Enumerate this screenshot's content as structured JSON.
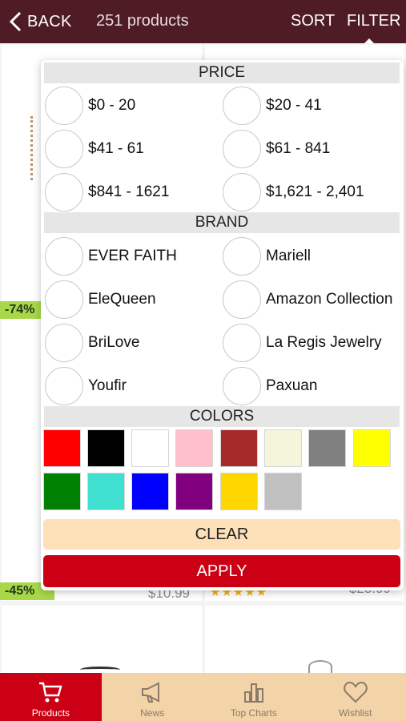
{
  "header": {
    "back_label": "BACK",
    "product_count": "251 products",
    "sort_label": "SORT",
    "filter_label": "FILTER"
  },
  "background_products": {
    "discount_1": "-74%",
    "discount_2": "-45%",
    "price_1": "$10.99",
    "price_2": "$23.99",
    "rating_stars": "★★★★★"
  },
  "filter": {
    "price_heading": "PRICE",
    "price_options": [
      "$0 - 20",
      "$20 - 41",
      "$41 - 61",
      "$61 - 841",
      "$841 - 1621",
      "$1,621 - 2,401"
    ],
    "brand_heading": "BRAND",
    "brand_options": [
      "EVER FAITH",
      "Mariell",
      "EleQueen",
      "Amazon Collection",
      "BriLove",
      "La Regis Jewelry",
      "Youfir",
      "Paxuan"
    ],
    "colors_heading": "COLORS",
    "colors": [
      {
        "name": "red",
        "hex": "#ff0000"
      },
      {
        "name": "black",
        "hex": "#000000"
      },
      {
        "name": "white",
        "hex": "#ffffff"
      },
      {
        "name": "pink",
        "hex": "#ffc0cb"
      },
      {
        "name": "brown",
        "hex": "#a52a2a"
      },
      {
        "name": "beige",
        "hex": "#f5f5dc"
      },
      {
        "name": "gray",
        "hex": "#808080"
      },
      {
        "name": "yellow",
        "hex": "#ffff00"
      },
      {
        "name": "green",
        "hex": "#008000"
      },
      {
        "name": "turquoise",
        "hex": "#40e0d0"
      },
      {
        "name": "blue",
        "hex": "#0000ff"
      },
      {
        "name": "purple",
        "hex": "#800080"
      },
      {
        "name": "gold",
        "hex": "#ffd700"
      },
      {
        "name": "silver",
        "hex": "#c0c0c0"
      }
    ],
    "clear_label": "CLEAR",
    "apply_label": "APPLY"
  },
  "tabbar": {
    "tabs": [
      {
        "label": "Products",
        "icon": "cart-icon",
        "active": true
      },
      {
        "label": "News",
        "icon": "megaphone-icon",
        "active": false
      },
      {
        "label": "Top Charts",
        "icon": "bar-chart-icon",
        "active": false
      },
      {
        "label": "Wishlist",
        "icon": "heart-icon",
        "active": false
      }
    ]
  },
  "theme": {
    "header_bg": "#4f1c26",
    "accent_red": "#cc0015",
    "clear_bg": "#fde0b8",
    "tabbar_bg": "#f3d3a8",
    "discount_green": "#a8d84a"
  }
}
